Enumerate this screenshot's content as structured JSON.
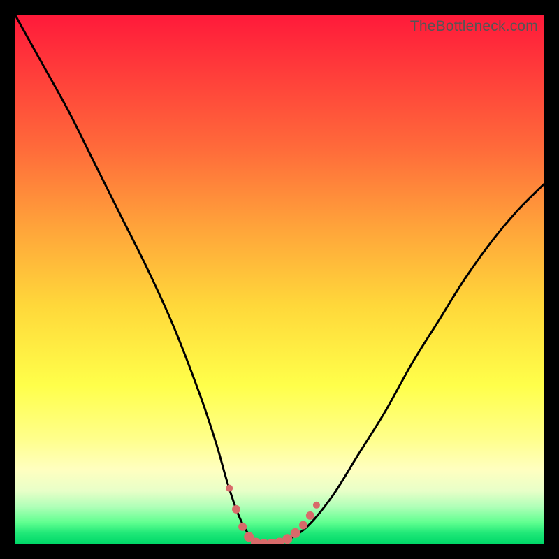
{
  "watermark": "TheBottleneck.com",
  "chart_data": {
    "type": "line",
    "title": "",
    "xlabel": "",
    "ylabel": "",
    "xlim": [
      0,
      100
    ],
    "ylim": [
      0,
      100
    ],
    "series": [
      {
        "name": "bottleneck-curve",
        "x": [
          0,
          5,
          10,
          15,
          20,
          25,
          30,
          35,
          38,
          40,
          42,
          44,
          46,
          48,
          50,
          55,
          60,
          65,
          70,
          75,
          80,
          85,
          90,
          95,
          100
        ],
        "values": [
          100,
          91,
          82,
          72,
          62,
          52,
          41,
          28,
          19,
          12,
          6,
          2,
          0,
          0,
          0,
          3,
          9,
          17,
          25,
          34,
          42,
          50,
          57,
          63,
          68
        ]
      }
    ],
    "markers": {
      "name": "trough-markers",
      "color": "#d86a6a",
      "points": [
        {
          "x": 40.5,
          "y": 10.5,
          "r": 5
        },
        {
          "x": 41.8,
          "y": 6.5,
          "r": 6
        },
        {
          "x": 43.0,
          "y": 3.2,
          "r": 6
        },
        {
          "x": 44.2,
          "y": 1.3,
          "r": 7
        },
        {
          "x": 45.5,
          "y": 0.2,
          "r": 7
        },
        {
          "x": 47.0,
          "y": 0.0,
          "r": 7
        },
        {
          "x": 48.5,
          "y": 0.0,
          "r": 7
        },
        {
          "x": 50.0,
          "y": 0.2,
          "r": 7
        },
        {
          "x": 51.5,
          "y": 0.9,
          "r": 7
        },
        {
          "x": 53.0,
          "y": 2.0,
          "r": 7
        },
        {
          "x": 54.5,
          "y": 3.5,
          "r": 6
        },
        {
          "x": 55.8,
          "y": 5.3,
          "r": 6
        },
        {
          "x": 57.0,
          "y": 7.3,
          "r": 5
        }
      ]
    }
  }
}
